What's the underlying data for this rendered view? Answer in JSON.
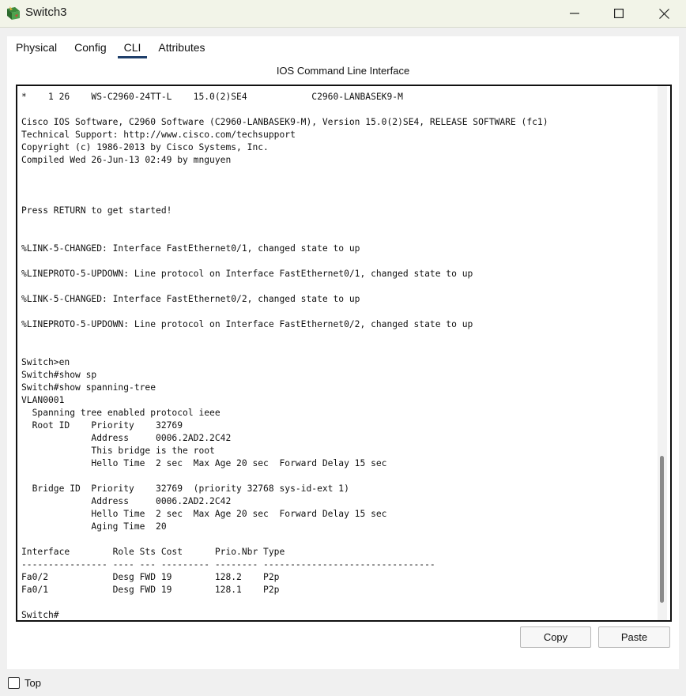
{
  "window": {
    "title": "Switch3",
    "controls": [
      "minimize-icon",
      "maximize-icon",
      "close-icon"
    ]
  },
  "tabs": [
    {
      "label": "Physical"
    },
    {
      "label": "Config"
    },
    {
      "label": "CLI",
      "active": true
    },
    {
      "label": "Attributes"
    }
  ],
  "panel": {
    "title": "IOS Command Line Interface"
  },
  "terminal": {
    "output": "*    1 26    WS-C2960-24TT-L    15.0(2)SE4            C2960-LANBASEK9-M\n\nCisco IOS Software, C2960 Software (C2960-LANBASEK9-M), Version 15.0(2)SE4, RELEASE SOFTWARE (fc1)\nTechnical Support: http://www.cisco.com/techsupport\nCopyright (c) 1986-2013 by Cisco Systems, Inc.\nCompiled Wed 26-Jun-13 02:49 by mnguyen\n\n\n\nPress RETURN to get started!\n\n\n%LINK-5-CHANGED: Interface FastEthernet0/1, changed state to up\n\n%LINEPROTO-5-UPDOWN: Line protocol on Interface FastEthernet0/1, changed state to up\n\n%LINK-5-CHANGED: Interface FastEthernet0/2, changed state to up\n\n%LINEPROTO-5-UPDOWN: Line protocol on Interface FastEthernet0/2, changed state to up\n\n\nSwitch>en\nSwitch#show sp\nSwitch#show spanning-tree\nVLAN0001\n  Spanning tree enabled protocol ieee\n  Root ID    Priority    32769\n             Address     0006.2AD2.2C42\n             This bridge is the root\n             Hello Time  2 sec  Max Age 20 sec  Forward Delay 15 sec\n\n  Bridge ID  Priority    32769  (priority 32768 sys-id-ext 1)\n             Address     0006.2AD2.2C42\n             Hello Time  2 sec  Max Age 20 sec  Forward Delay 15 sec\n             Aging Time  20\n\nInterface        Role Sts Cost      Prio.Nbr Type\n---------------- ---- --- --------- -------- --------------------------------\nFa0/2            Desg FWD 19        128.2    P2p\nFa0/1            Desg FWD 19        128.1    P2p\n\nSwitch#",
    "scroll_position": 0.72
  },
  "buttons": {
    "copy": "Copy",
    "paste": "Paste"
  },
  "top_checkbox": {
    "label": "Top",
    "checked": false
  }
}
